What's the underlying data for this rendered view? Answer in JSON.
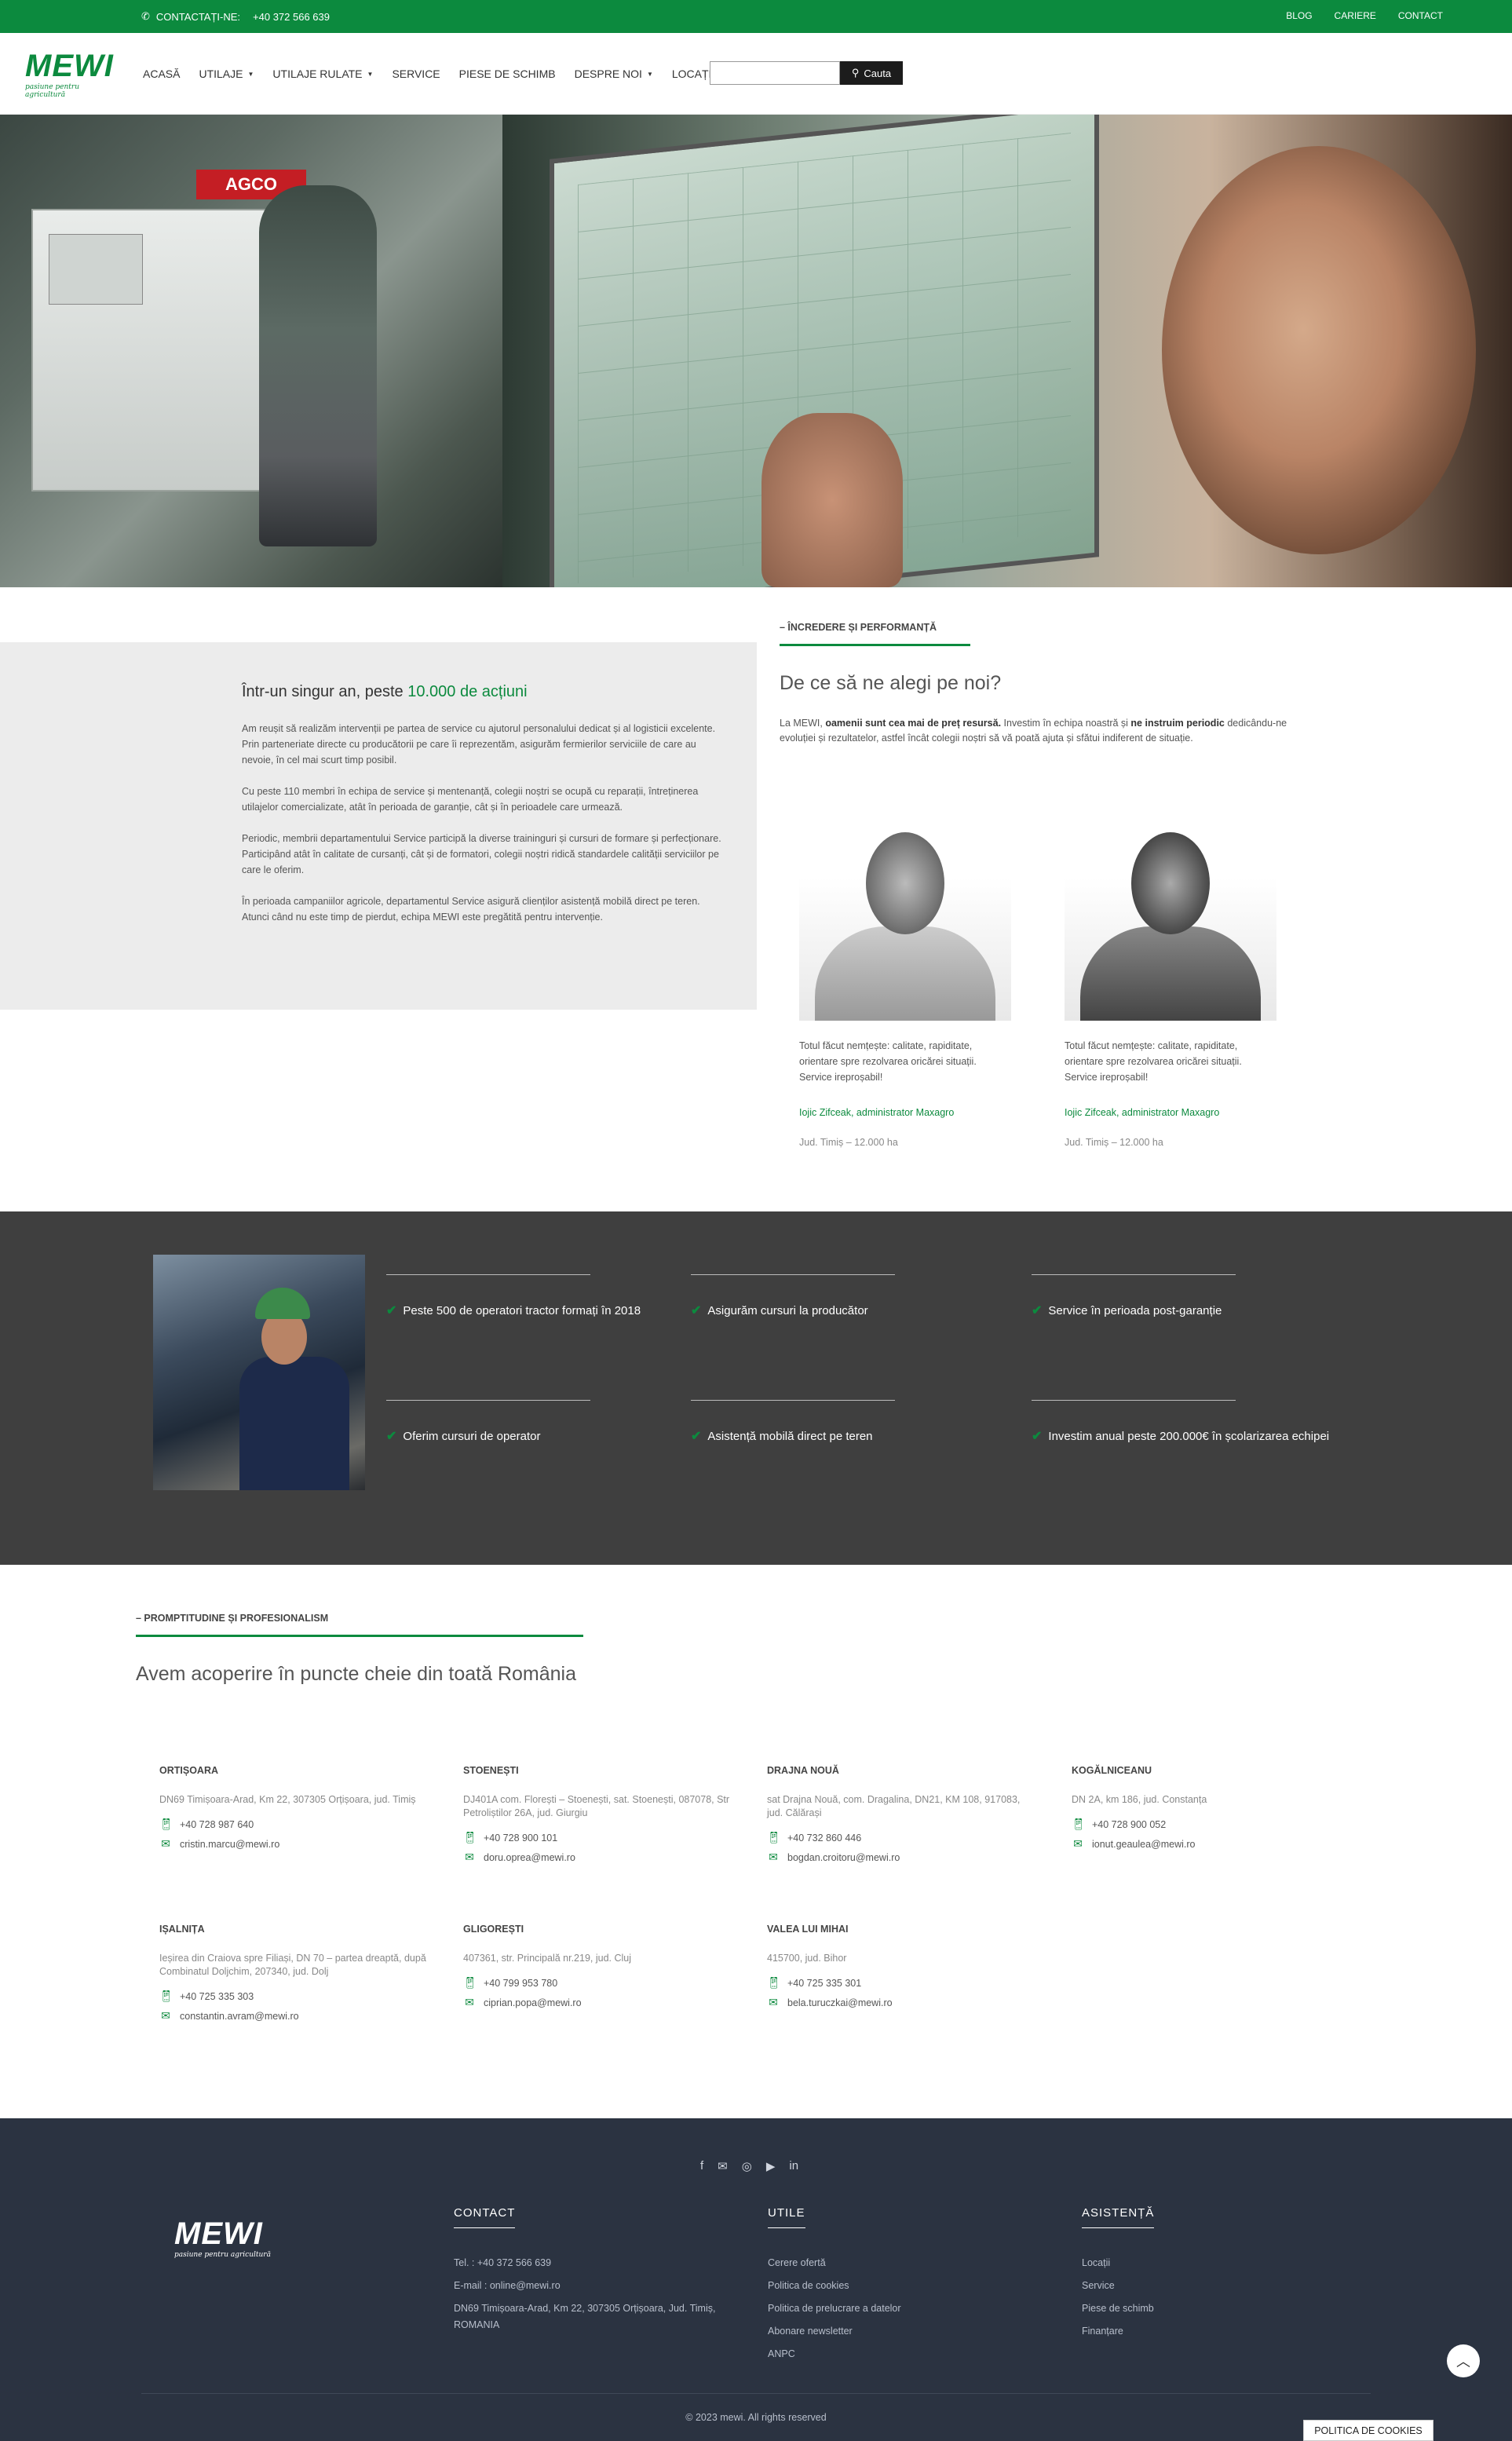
{
  "topbar": {
    "contact_label": "CONTACTAȚI-NE:",
    "phone": "+40 372 566 639",
    "links": [
      "BLOG",
      "CARIERE",
      "CONTACT"
    ]
  },
  "header": {
    "logo_text": "MEWI",
    "logo_tagline": "pasiune pentru agricultură",
    "nav": [
      "ACASĂ",
      "UTILAJE",
      "UTILAJE RULATE",
      "SERVICE",
      "PIESE DE SCHIMB",
      "DESPRE NOI",
      "LOCAȚII"
    ],
    "search": {
      "value": "",
      "button_label": "Cauta"
    }
  },
  "hero": {
    "brand_sign": "AGCO"
  },
  "trust": {
    "title_prefix": "Într-un singur an, peste",
    "title_highlight": "10.000 de acțiuni",
    "paragraphs": [
      "Am reușit să realizăm intervenții pe partea de service cu ajutorul personalului dedicat și al logisticii excelente. Prin parteneriate directe cu producătorii pe care îi reprezentăm, asigurăm fermierilor serviciile de care au nevoie, în cel mai scurt timp posibil.",
      "Cu peste 110 membri în echipa de service și mentenanță, colegii noștri se ocupă cu reparații, întreținerea utilajelor comercializate, atât în perioada de garanție, cât și în perioadele care urmează.",
      "Periodic, membrii departamentului Service participă la diverse traininguri și cursuri de formare și perfecționare. Participând atât în calitate de cursanți, cât și de formatori, colegii noștri ridică standardele calității serviciilor pe care le oferim.",
      "În perioada campaniilor agricole, departamentul Service asigură clienților asistență mobilă direct pe teren. Atunci când nu este timp de pierdut, echipa MEWI este pregătită pentru intervenție."
    ]
  },
  "why": {
    "kicker": "– ÎNCREDERE ȘI PERFORMANȚĂ",
    "title": "De ce să ne alegi pe noi?",
    "text_1": "La MEWI, ",
    "text_bold_1": "oamenii sunt cea mai de preț resursă.",
    "text_2": " Investim în echipa noastră și ",
    "text_bold_2": "ne instruim periodic",
    "text_3": " dedicându-ne evoluției și rezultatelor, astfel încât colegii noștri să vă poată ajuta și sfătui indiferent de situație.",
    "testimonials": [
      {
        "quote": "Totul făcut nemțește: calitate, rapiditate, orientare spre rezolvarea oricărei situații. Service ireproșabil!",
        "author": "Iojic Zifceak, administrator Maxagro",
        "meta": "Jud. Timiș – 12.000 ha"
      },
      {
        "quote": "Totul făcut nemțește: calitate, rapiditate, orientare spre rezolvarea oricărei situații. Service ireproșabil!",
        "author": "Iojic Zifceak, administrator Maxagro",
        "meta": "Jud. Timiș – 12.000 ha"
      }
    ]
  },
  "features": [
    "Peste 500 de operatori tractor formați în 2018",
    "Asigurăm cursuri la producător",
    "Service în perioada post-garanție",
    "Oferim cursuri de operator",
    "Asistență mobilă direct pe teren",
    "Investim anual peste 200.000€ în școlarizarea echipei"
  ],
  "coverage": {
    "kicker": "– PROMPTITUDINE ȘI PROFESIONALISM",
    "title": "Avem acoperire în puncte cheie din toată România",
    "locations": [
      {
        "name": "ORTIȘOARA",
        "address": "DN69 Timișoara-Arad, Km 22, 307305 Orțișoara, jud. Timiș",
        "phone": "+40 728 987 640",
        "email": "cristin.marcu@mewi.ro"
      },
      {
        "name": "STOENEȘTI",
        "address": "DJ401A com. Florești – Stoenești, sat. Stoenești, 087078, Str Petroliștilor 26A, jud. Giurgiu",
        "phone": "+40 728 900 101",
        "email": "doru.oprea@mewi.ro"
      },
      {
        "name": "DRAJNA NOUĂ",
        "address": "sat Drajna Nouă, com. Dragalina, DN21, KM 108, 917083, jud. Călărași",
        "phone": "+40 732 860 446",
        "email": "bogdan.croitoru@mewi.ro"
      },
      {
        "name": "KOGĂLNICEANU",
        "address": "DN 2A, km 186, jud. Constanța",
        "phone": "+40 728 900 052",
        "email": "ionut.geaulea@mewi.ro"
      },
      {
        "name": "IȘALNIȚA",
        "address": "Ieșirea din Craiova spre Filiași, DN 70 – partea dreaptă, după Combinatul Doljchim, 207340, jud. Dolj",
        "phone": "+40 725 335 303",
        "email": "constantin.avram@mewi.ro"
      },
      {
        "name": "GLIGOREȘTI",
        "address": "407361, str. Principală nr.219, jud. Cluj",
        "phone": "+40 799 953 780",
        "email": "ciprian.popa@mewi.ro"
      },
      {
        "name": "VALEA LUI MIHAI",
        "address": "415700, jud. Bihor",
        "phone": "+40 725 335 301",
        "email": "bela.turuczkai@mewi.ro"
      }
    ]
  },
  "footer": {
    "social_icons": [
      "facebook-icon",
      "mail-icon",
      "instagram-icon",
      "youtube-icon",
      "linkedin-icon"
    ],
    "contact_title": "CONTACT",
    "contact_tel": "Tel. : +40 372 566 639",
    "contact_email": "E-mail : online@mewi.ro",
    "contact_address": "DN69 Timișoara-Arad, Km 22, 307305 Orțișoara, Jud. Timiș, ROMANIA",
    "utile_title": "UTILE",
    "utile_links": [
      "Cerere ofertă",
      "Politica de cookies",
      "Politica de prelucrare a datelor",
      "Abonare newsletter",
      "ANPC"
    ],
    "asistenta_title": "ASISTENȚĂ",
    "asistenta_links": [
      "Locații",
      "Service",
      "Piese de schimb",
      "Finanțare"
    ],
    "copyright": "© 2023 mewi. All rights reserved",
    "cookie_button": "POLITICA DE COOKIES"
  },
  "colors": {
    "brand_green": "#0c8a3e",
    "dark_band": "#3f3f3f",
    "footer_bg": "#2b3341"
  }
}
